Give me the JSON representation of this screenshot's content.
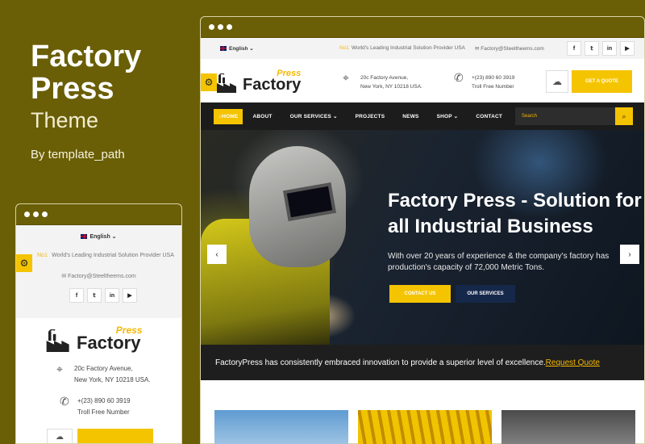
{
  "promo": {
    "title_line1": "Factory",
    "title_line2": "Press",
    "subtitle": "Theme",
    "byline": "By template_path"
  },
  "site": {
    "language": "English",
    "language_caret": "⌄",
    "tagline_prefix": "No1",
    "tagline": "World's Leading Industrial Solution Provider USA",
    "email": "Factory@Steeltheems.com",
    "socials": [
      "f",
      "𝕥",
      "in",
      "▶"
    ],
    "logo_press": "Press",
    "logo_factory": "Factory",
    "address_line1": "20c Factory Avenue,",
    "address_line2": "New York, NY 10218 USA.",
    "phone": "+(23) 890 60 3919",
    "phone_label": "Troll Free Number",
    "quote_button": "GET A QUOTE",
    "nav": [
      {
        "label": "HOME",
        "icon": "home-icon"
      },
      {
        "label": "ABOUT"
      },
      {
        "label": "OUR SERVICES ⌄"
      },
      {
        "label": "PROJECTS"
      },
      {
        "label": "NEWS"
      },
      {
        "label": "SHOP ⌄"
      },
      {
        "label": "CONTACT"
      }
    ],
    "search_placeholder": "Search",
    "hero": {
      "title": "Factory Press - Solution for all Industrial Business",
      "text": "With over 20 years of experience & the company's factory has production's capacity of 72,000 Metric Tons.",
      "btn_contact": "CONTACT US",
      "btn_services": "OUR SERVICES"
    },
    "banner_text": "FactoryPress has consistently embraced innovation to provide a superior level of excellence.",
    "banner_link": "Request Quote"
  },
  "icons": {
    "gear": "⚙",
    "location": "⌖",
    "phone": "✆",
    "mail": "✉",
    "cloud": "☁",
    "search": "⌕",
    "arrow_left": "‹",
    "arrow_right": "›",
    "home": "⌂"
  },
  "colors": {
    "background": "#6a5e06",
    "accent": "#f5c400",
    "nav_bg": "#1c1c1c",
    "dark_blue": "#16284a"
  }
}
